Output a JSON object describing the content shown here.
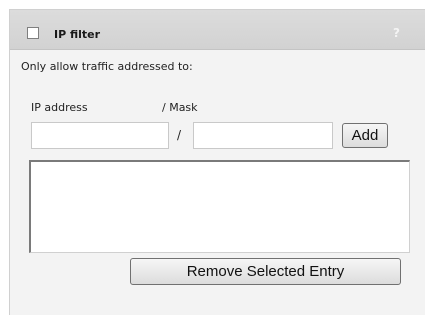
{
  "header": {
    "title": "IP filter",
    "help_glyph": "?",
    "checkbox_checked": false
  },
  "section": {
    "description": "Only allow traffic addressed to:"
  },
  "form": {
    "ip_label": "IP address",
    "mask_label": "/ Mask",
    "separator": "/",
    "ip_value": "",
    "mask_value": "",
    "add_label": "Add"
  },
  "entries": [],
  "actions": {
    "remove_label": "Remove Selected Entry"
  },
  "colors": {
    "header_bg": "#d6d6d6",
    "panel_bg": "#f3f3f3",
    "focus_border": "#7fa8d6"
  }
}
